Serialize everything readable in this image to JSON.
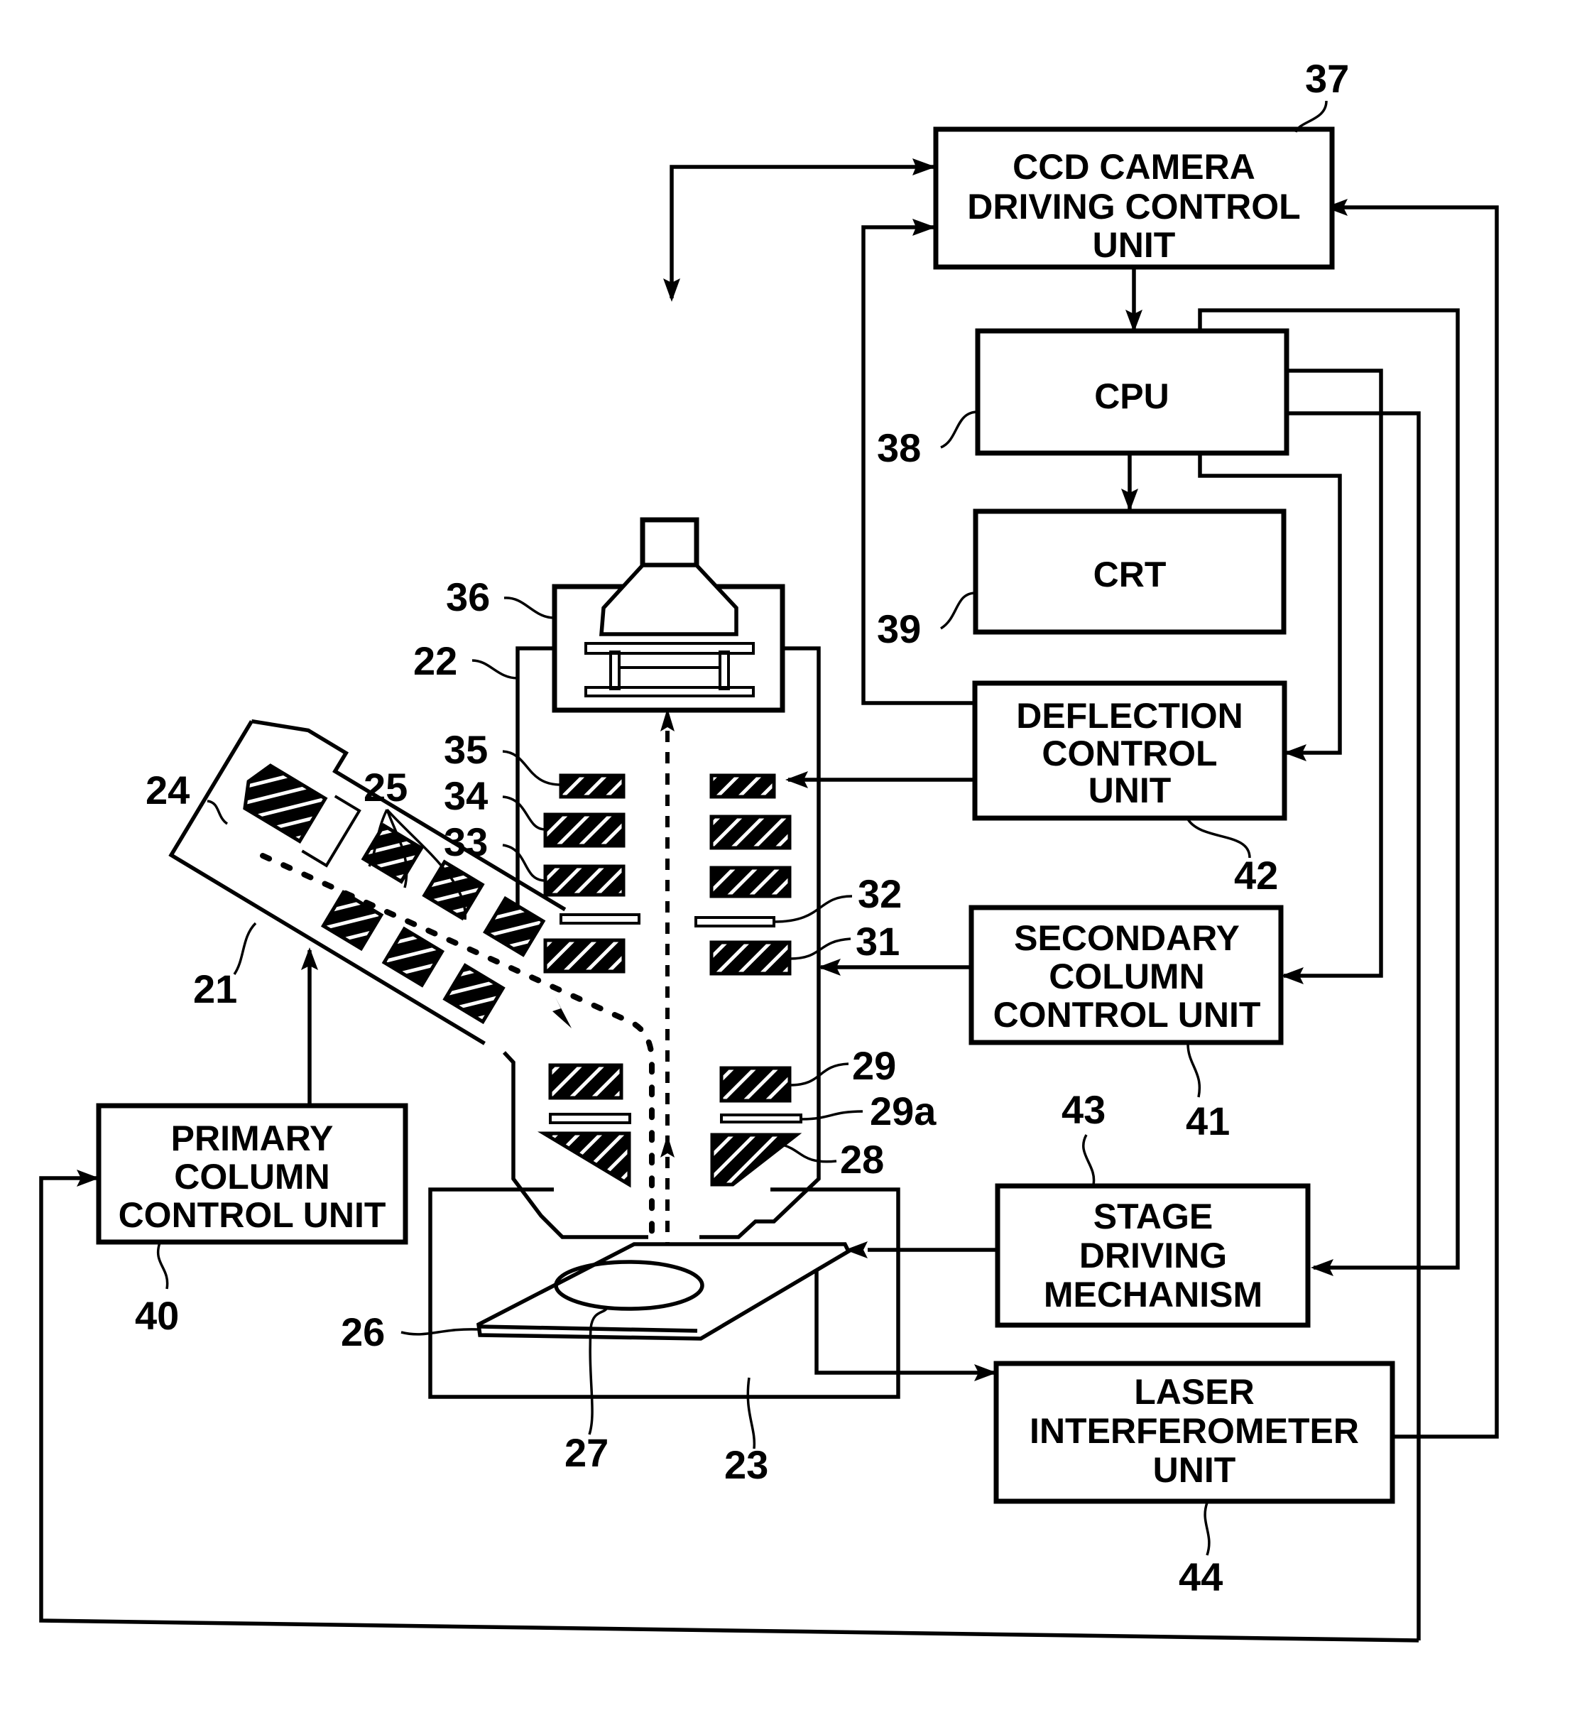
{
  "figure": {
    "type": "block-diagram",
    "subject": "Electron beam inspection apparatus with primary/secondary columns"
  },
  "blocks": {
    "ccd": {
      "ref": "37",
      "lines": [
        "CCD CAMERA",
        "DRIVING CONTROL",
        "UNIT"
      ]
    },
    "cpu": {
      "ref": "38",
      "lines": [
        "CPU"
      ]
    },
    "crt": {
      "ref": "39",
      "lines": [
        "CRT"
      ]
    },
    "deflection": {
      "ref": "42",
      "lines": [
        "DEFLECTION",
        "CONTROL",
        "UNIT"
      ]
    },
    "secondary": {
      "ref": "41",
      "lines": [
        "SECONDARY",
        "COLUMN",
        "CONTROL UNIT"
      ]
    },
    "stage": {
      "ref": "43",
      "lines": [
        "STAGE",
        "DRIVING",
        "MECHANISM"
      ]
    },
    "laser": {
      "ref": "44",
      "lines": [
        "LASER",
        "INTERFEROMETER",
        "UNIT"
      ]
    },
    "primary": {
      "ref": "40",
      "lines": [
        "PRIMARY",
        "COLUMN",
        "CONTROL UNIT"
      ]
    }
  },
  "component_refs": {
    "primary_column": "21",
    "secondary_column": "22",
    "chamber": "23",
    "electron_gun": "24",
    "primary_lenses": "25",
    "stage": "26",
    "sample": "27",
    "objective_lens": "28",
    "lens_29": "29",
    "plate_29a": "29a",
    "lens_31": "31",
    "plate_32": "32",
    "lens_33": "33",
    "lens_34": "34",
    "deflector_35": "35",
    "detector_36": "36"
  }
}
